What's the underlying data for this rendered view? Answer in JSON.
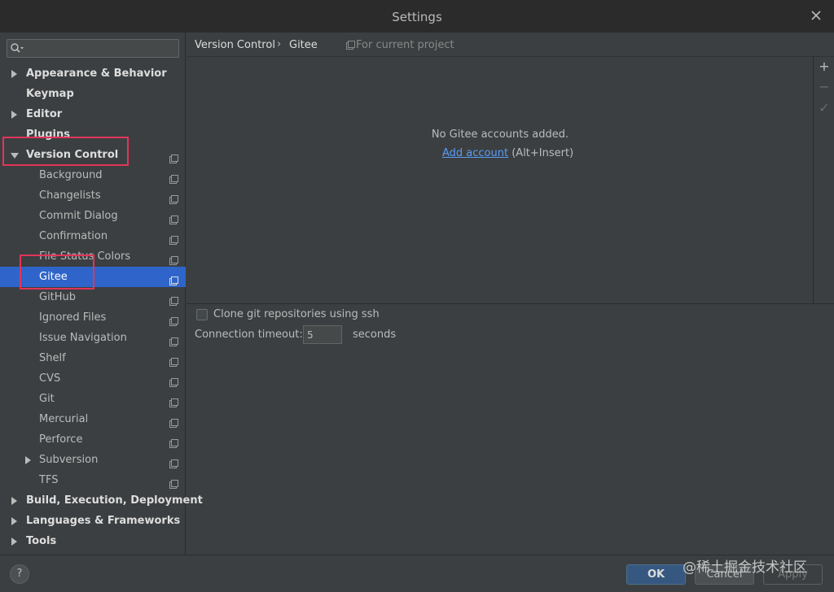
{
  "window": {
    "title": "Settings"
  },
  "search": {
    "placeholder": ""
  },
  "tree": [
    {
      "label": "Appearance & Behavior",
      "level": "top",
      "expander": "right",
      "project": false
    },
    {
      "label": "Keymap",
      "level": "top",
      "expander": "none",
      "project": false
    },
    {
      "label": "Editor",
      "level": "top",
      "expander": "right",
      "project": false
    },
    {
      "label": "Plugins",
      "level": "top",
      "expander": "none",
      "project": false
    },
    {
      "label": "Version Control",
      "level": "top",
      "expander": "down",
      "project": true
    },
    {
      "label": "Background",
      "level": "child",
      "expander": "none",
      "project": true
    },
    {
      "label": "Changelists",
      "level": "child",
      "expander": "none",
      "project": true
    },
    {
      "label": "Commit Dialog",
      "level": "child",
      "expander": "none",
      "project": true
    },
    {
      "label": "Confirmation",
      "level": "child",
      "expander": "none",
      "project": true
    },
    {
      "label": "File Status Colors",
      "level": "child",
      "expander": "none",
      "project": true
    },
    {
      "label": "Gitee",
      "level": "child",
      "expander": "none",
      "project": true,
      "selected": true
    },
    {
      "label": "GitHub",
      "level": "child",
      "expander": "none",
      "project": true
    },
    {
      "label": "Ignored Files",
      "level": "child",
      "expander": "none",
      "project": true
    },
    {
      "label": "Issue Navigation",
      "level": "child",
      "expander": "none",
      "project": true
    },
    {
      "label": "Shelf",
      "level": "child",
      "expander": "none",
      "project": true
    },
    {
      "label": "CVS",
      "level": "child",
      "expander": "none",
      "project": true
    },
    {
      "label": "Git",
      "level": "child",
      "expander": "none",
      "project": true
    },
    {
      "label": "Mercurial",
      "level": "child",
      "expander": "none",
      "project": true
    },
    {
      "label": "Perforce",
      "level": "child",
      "expander": "none",
      "project": true
    },
    {
      "label": "Subversion",
      "level": "child",
      "expander": "right",
      "project": true
    },
    {
      "label": "TFS",
      "level": "child",
      "expander": "none",
      "project": true
    },
    {
      "label": "Build, Execution, Deployment",
      "level": "top",
      "expander": "right",
      "project": false
    },
    {
      "label": "Languages & Frameworks",
      "level": "top",
      "expander": "right",
      "project": false
    },
    {
      "label": "Tools",
      "level": "top",
      "expander": "right",
      "project": false
    }
  ],
  "breadcrumb": {
    "parent": "Version Control",
    "separator": "›",
    "current": "Gitee",
    "scope": "For current project"
  },
  "accounts": {
    "empty_text": "No Gitee accounts added.",
    "add_link": "Add account",
    "shortcut": "(Alt+Insert)"
  },
  "toolbar": {
    "add": "+",
    "remove": "−",
    "default": "✓"
  },
  "options": {
    "clone_ssh_label": "Clone git repositories using ssh",
    "clone_ssh_checked": false,
    "timeout_label": "Connection timeout:",
    "timeout_value": "5",
    "timeout_unit": "seconds"
  },
  "footer": {
    "help": "?",
    "ok": "OK",
    "cancel": "Cancel",
    "apply": "Apply"
  },
  "watermark": "@稀土掘金技术社区",
  "colors": {
    "accent": "#2f65ca",
    "link": "#589df6",
    "highlight": "#e3345a",
    "background": "#3c3f41"
  }
}
